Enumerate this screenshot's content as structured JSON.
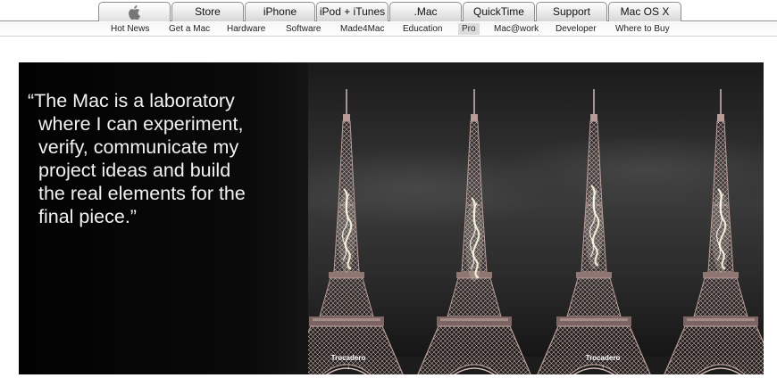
{
  "nav": {
    "tabs": [
      {
        "label": "",
        "icon": "apple-logo-icon"
      },
      {
        "label": "Store"
      },
      {
        "label": "iPhone"
      },
      {
        "label": "iPod + iTunes"
      },
      {
        "label": ".Mac"
      },
      {
        "label": "QuickTime"
      },
      {
        "label": "Support"
      },
      {
        "label": "Mac OS X"
      }
    ],
    "sub": [
      {
        "label": "Hot News"
      },
      {
        "label": "Get a Mac"
      },
      {
        "label": "Hardware"
      },
      {
        "label": "Software"
      },
      {
        "label": "Made4Mac"
      },
      {
        "label": "Education"
      },
      {
        "label": "Pro",
        "active": true
      },
      {
        "label": "Mac@work"
      },
      {
        "label": "Developer"
      },
      {
        "label": "Where to Buy"
      }
    ]
  },
  "hero": {
    "quote_lines": [
      "“The Mac is a laboratory",
      "where I can experiment,",
      "verify, communicate my",
      "project ideas and build",
      "the real elements for the",
      "final piece.”"
    ],
    "signs": [
      {
        "label": "Trocadero",
        "arrow": "down-arrow-icon"
      },
      {
        "label": "Trocadero",
        "arrow": "up-arrow-icon"
      }
    ]
  },
  "colors": {
    "hero_bg": "#050505",
    "quote_text": "#f2f2f2",
    "tower": "#b89c98",
    "glow": "#f4f0d8"
  }
}
